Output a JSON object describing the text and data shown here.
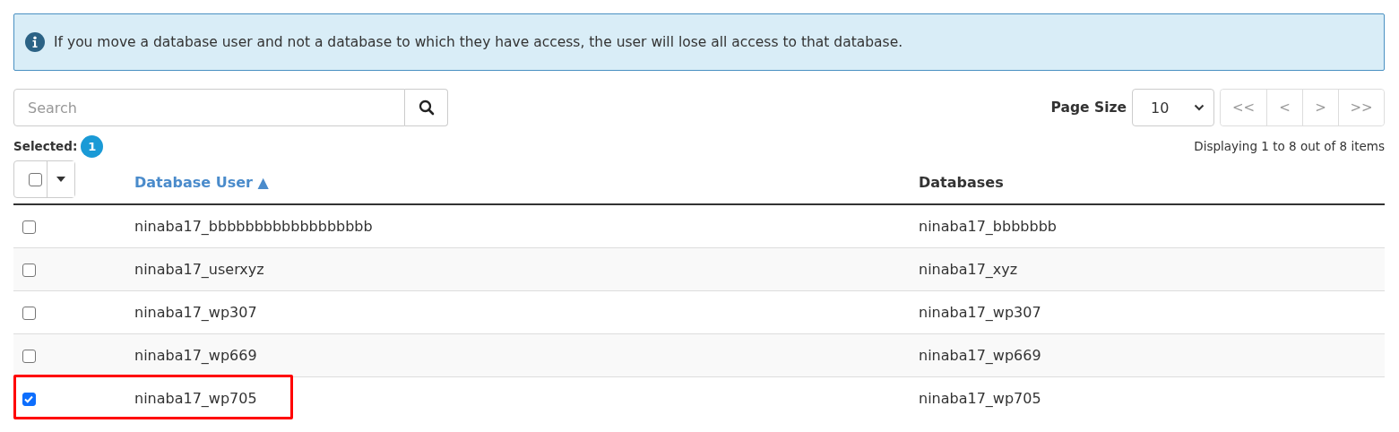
{
  "alert": {
    "text": "If you move a database user and not a database to which they have access, the user will lose all access to that database."
  },
  "search": {
    "placeholder": "Search"
  },
  "page_size": {
    "label": "Page Size",
    "value": "10"
  },
  "pager": [
    "<<",
    "<",
    ">",
    ">>"
  ],
  "selected": {
    "label": "Selected:",
    "count": "1"
  },
  "displaying": "Displaying 1 to 8 out of 8 items",
  "table": {
    "select_all": {
      "checked": false
    },
    "columns": [
      {
        "label": "Database User ▲",
        "sorted": true
      },
      {
        "label": "Databases",
        "sorted": false
      }
    ],
    "rows": [
      {
        "user": "ninaba17_bbbbbbbbbbbbbbbbbb",
        "database": "ninaba17_bbbbbbb",
        "checked": false,
        "highlighted": false
      },
      {
        "user": "ninaba17_userxyz",
        "database": "ninaba17_xyz",
        "checked": false,
        "highlighted": false
      },
      {
        "user": "ninaba17_wp307",
        "database": "ninaba17_wp307",
        "checked": false,
        "highlighted": false
      },
      {
        "user": "ninaba17_wp669",
        "database": "ninaba17_wp669",
        "checked": false,
        "highlighted": false
      },
      {
        "user": "ninaba17_wp705",
        "database": "ninaba17_wp705",
        "checked": true,
        "highlighted": true
      }
    ]
  }
}
